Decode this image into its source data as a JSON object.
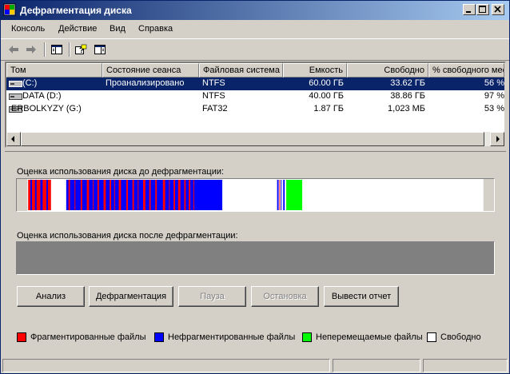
{
  "window": {
    "title": "Дефрагментация диска"
  },
  "menu": [
    "Консоль",
    "Действие",
    "Вид",
    "Справка"
  ],
  "toolbar_icons": [
    "back-arrow-icon",
    "forward-arrow-icon",
    "show-hide-tree-icon",
    "help-icon",
    "properties-icon"
  ],
  "volumes": {
    "columns": [
      "Том",
      "Состояние сеанса",
      "Файловая система",
      "Емкость",
      "Свободно",
      "% свободного мес"
    ],
    "rows": [
      {
        "name": "(C:)",
        "status": "Проанализировано",
        "fs": "NTFS",
        "capacity": "60.00 ГБ",
        "free": "33.62 ГБ",
        "pct": "56 %",
        "selected": true
      },
      {
        "name": "DATA (D:)",
        "status": "",
        "fs": "NTFS",
        "capacity": "40.00 ГБ",
        "free": "38.86 ГБ",
        "pct": "97 %",
        "selected": false
      },
      {
        "name": "ERBOLKYZY (G:)",
        "status": "",
        "fs": "FAT32",
        "capacity": "1.87 ГБ",
        "free": "1,023 МБ",
        "pct": "53 %",
        "selected": false
      }
    ]
  },
  "analysis": {
    "before_label": "Оценка использования диска до дефрагментации:",
    "after_label": "Оценка использования диска после дефрагментации:"
  },
  "buttons": {
    "analyze": "Анализ",
    "defrag": "Дефрагментация",
    "pause": "Пауза",
    "stop": "Остановка",
    "report": "Вывести отчет"
  },
  "legend": [
    {
      "label": "Фрагментированные файлы",
      "color": "#ff0000"
    },
    {
      "label": "Нефрагментированные файлы",
      "color": "#0000ff"
    },
    {
      "label": "Неперемещаемые файлы",
      "color": "#00ff00"
    },
    {
      "label": "Свободно",
      "color": "#ffffff"
    }
  ],
  "colors": {
    "fragmented": "#ff0000",
    "contiguous": "#0000ff",
    "unmovable": "#00ff00",
    "free": "#ffffff",
    "after_empty": "#808080"
  }
}
